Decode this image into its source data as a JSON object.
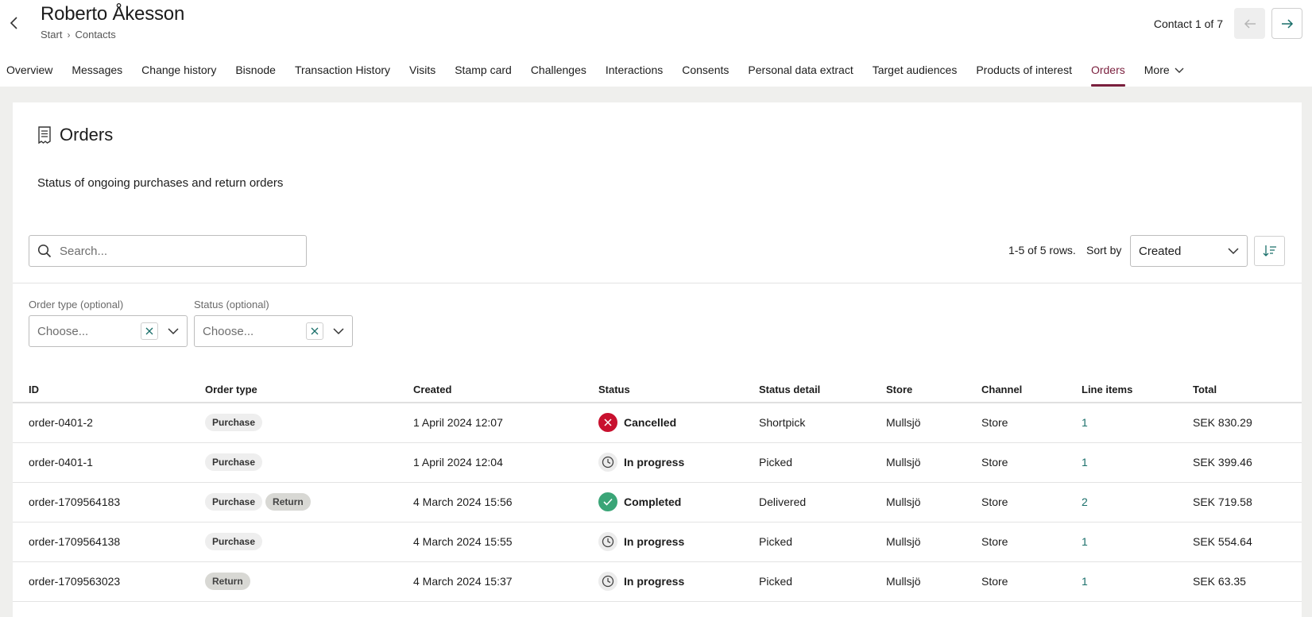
{
  "header": {
    "title": "Roberto Åkesson",
    "breadcrumb": [
      "Start",
      "Contacts"
    ],
    "contact_counter": "Contact 1 of 7"
  },
  "tabs": [
    {
      "label": "Overview"
    },
    {
      "label": "Messages"
    },
    {
      "label": "Change history"
    },
    {
      "label": "Bisnode"
    },
    {
      "label": "Transaction History"
    },
    {
      "label": "Visits"
    },
    {
      "label": "Stamp card"
    },
    {
      "label": "Challenges"
    },
    {
      "label": "Interactions"
    },
    {
      "label": "Consents"
    },
    {
      "label": "Personal data extract"
    },
    {
      "label": "Target audiences"
    },
    {
      "label": "Products of interest"
    },
    {
      "label": "Orders",
      "active": true
    },
    {
      "label": "More"
    }
  ],
  "orders": {
    "title": "Orders",
    "description": "Status of ongoing purchases and return orders",
    "search_placeholder": "Search...",
    "rows_info": "1-5 of 5 rows.",
    "sort_label": "Sort by",
    "sort_value": "Created",
    "filters": {
      "order_type_label": "Order type (optional)",
      "order_type_placeholder": "Choose...",
      "status_label": "Status (optional)",
      "status_placeholder": "Choose..."
    },
    "columns": [
      "ID",
      "Order type",
      "Created",
      "Status",
      "Status detail",
      "Store",
      "Channel",
      "Line items",
      "Total"
    ],
    "rows": [
      {
        "id": "order-0401-2",
        "types": [
          "Purchase"
        ],
        "created": "1 April 2024 12:07",
        "status": "Cancelled",
        "status_icon": "x-circle-icon",
        "status_detail": "Shortpick",
        "store": "Mullsjö",
        "channel": "Store",
        "line_items": "1",
        "total": "SEK 830.29"
      },
      {
        "id": "order-0401-1",
        "types": [
          "Purchase"
        ],
        "created": "1 April 2024 12:04",
        "status": "In progress",
        "status_icon": "clock-icon",
        "status_detail": "Picked",
        "store": "Mullsjö",
        "channel": "Store",
        "line_items": "1",
        "total": "SEK 399.46"
      },
      {
        "id": "order-1709564183",
        "types": [
          "Purchase",
          "Return"
        ],
        "created": "4 March 2024 15:56",
        "status": "Completed",
        "status_icon": "check-circle-icon",
        "status_detail": "Delivered",
        "store": "Mullsjö",
        "channel": "Store",
        "line_items": "2",
        "total": "SEK 719.58"
      },
      {
        "id": "order-1709564138",
        "types": [
          "Purchase"
        ],
        "created": "4 March 2024 15:55",
        "status": "In progress",
        "status_icon": "clock-icon",
        "status_detail": "Picked",
        "store": "Mullsjö",
        "channel": "Store",
        "line_items": "1",
        "total": "SEK 554.64"
      },
      {
        "id": "order-1709563023",
        "types": [
          "Return"
        ],
        "created": "4 March 2024 15:37",
        "status": "In progress",
        "status_icon": "clock-icon",
        "status_detail": "Picked",
        "store": "Mullsjö",
        "channel": "Store",
        "line_items": "1",
        "total": "SEK 63.35"
      }
    ]
  },
  "colors": {
    "accent": "#7a1f3d",
    "cancelled": "#c8102e",
    "completed": "#3aa577",
    "link": "#1a6f6a"
  }
}
